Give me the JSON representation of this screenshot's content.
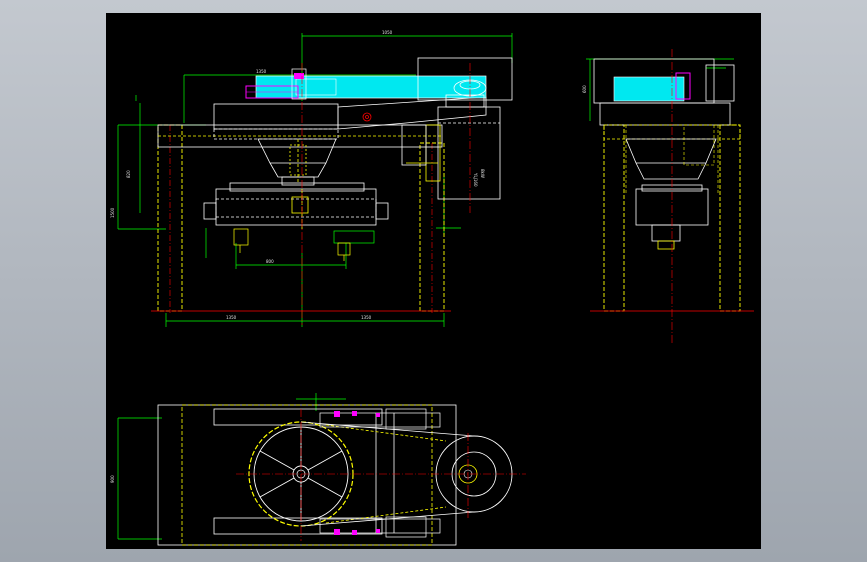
{
  "drawing": {
    "background": "#000000",
    "window_background": "#aab0b9",
    "colors": {
      "yellow": "#ffff00",
      "green": "#00ff00",
      "white": "#ffffff",
      "cyan": "#00ffff",
      "magenta": "#ff00ff",
      "red": "#ff0000",
      "orange": "#ff8000"
    },
    "views": [
      "front-view",
      "side-view",
      "top-view"
    ]
  }
}
